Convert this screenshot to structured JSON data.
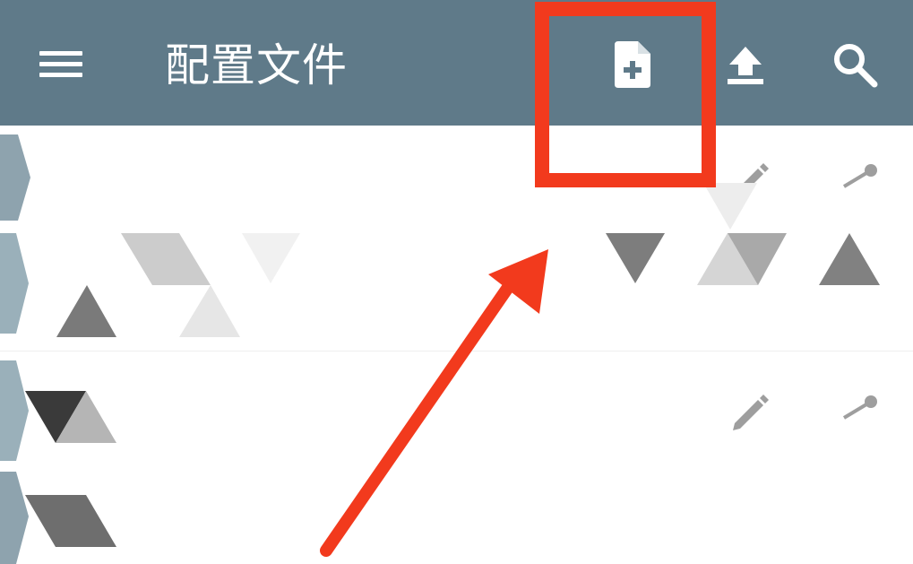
{
  "app": {
    "title": "配置文件"
  },
  "toolbar": {
    "menu_icon": "hamburger-menu-icon",
    "add_icon": "note-add-icon",
    "upload_icon": "upload-icon",
    "search_icon": "search-icon"
  },
  "profiles": [
    {
      "edit_icon": "pencil-icon",
      "share_icon": "share-icon"
    },
    {
      "edit_icon": "pencil-icon",
      "share_icon": "share-icon"
    }
  ],
  "colors": {
    "toolbar": "#5f7a89",
    "toolbar_icons": "#ffffff",
    "annotation": "#f23a1d",
    "left_stripe": "#8ea3ae"
  }
}
